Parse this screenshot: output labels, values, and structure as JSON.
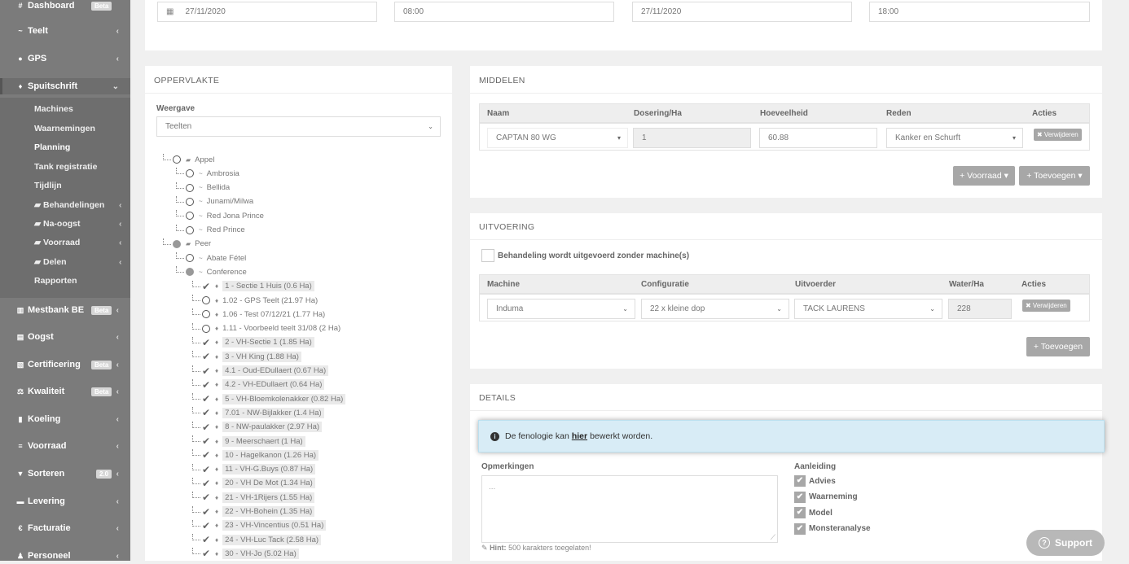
{
  "sidebar": {
    "items": [
      {
        "icon": "#",
        "label": "Dashboard",
        "badge": "Beta",
        "caret": ""
      },
      {
        "icon": "~",
        "label": "Teelt",
        "badge": "",
        "caret": "‹"
      },
      {
        "icon": "●",
        "label": "GPS",
        "badge": "",
        "caret": "‹"
      },
      {
        "icon": "♦",
        "label": "Spuitschrift",
        "badge": "",
        "caret": "⌄"
      },
      {
        "icon": "▥",
        "label": "Mestbank BE",
        "badge": "Beta",
        "caret": "‹"
      },
      {
        "icon": "▤",
        "label": "Oogst",
        "badge": "",
        "caret": "‹"
      },
      {
        "icon": "▧",
        "label": "Certificering",
        "badge": "Beta",
        "caret": "‹"
      },
      {
        "icon": "⚖",
        "label": "Kwaliteit",
        "badge": "Beta",
        "caret": "‹"
      },
      {
        "icon": "▮",
        "label": "Koeling",
        "badge": "",
        "caret": "‹"
      },
      {
        "icon": "≡",
        "label": "Voorraad",
        "badge": "",
        "caret": "‹"
      },
      {
        "icon": "▼",
        "label": "Sorteren",
        "badge": "2.0",
        "caret": "‹"
      },
      {
        "icon": "▬",
        "label": "Levering",
        "badge": "",
        "caret": "‹"
      },
      {
        "icon": "€",
        "label": "Facturatie",
        "badge": "",
        "caret": "‹"
      },
      {
        "icon": "♟",
        "label": "Personeel",
        "badge": "",
        "caret": "‹"
      }
    ],
    "sub": [
      {
        "label": "Machines",
        "caret": ""
      },
      {
        "label": "Waarnemingen",
        "caret": ""
      },
      {
        "label": "Planning",
        "caret": ""
      },
      {
        "label": "Tank registratie",
        "caret": ""
      },
      {
        "label": "Tijdlijn",
        "caret": ""
      },
      {
        "label": "▰ Behandelingen",
        "caret": "‹"
      },
      {
        "label": "▰ Na-oogst",
        "caret": "‹"
      },
      {
        "label": "▰ Voorraad",
        "caret": "‹"
      },
      {
        "label": "▰ Delen",
        "caret": "‹"
      },
      {
        "label": "Rapporten",
        "caret": ""
      }
    ]
  },
  "top": {
    "date1": "27/11/2020",
    "time1": "08:00",
    "date2": "27/11/2020",
    "time2": "18:00"
  },
  "oppervlakte": {
    "title": "OPPERVLAKTE",
    "weergave_label": "Weergave",
    "weergave_value": "Teelten",
    "tree": [
      {
        "level": 0,
        "state": "open",
        "icon": "▰",
        "text": "Appel",
        "hl": false
      },
      {
        "level": 1,
        "state": "open",
        "icon": "~",
        "text": "Ambrosia",
        "hl": false
      },
      {
        "level": 1,
        "state": "open",
        "icon": "~",
        "text": "Bellida",
        "hl": false
      },
      {
        "level": 1,
        "state": "open",
        "icon": "~",
        "text": "Junami/Milwa",
        "hl": false
      },
      {
        "level": 1,
        "state": "open",
        "icon": "~",
        "text": "Red Jona Prince",
        "hl": false
      },
      {
        "level": 1,
        "state": "open",
        "icon": "~",
        "text": "Red Prince",
        "hl": false
      },
      {
        "level": 0,
        "state": "filled",
        "icon": "▰",
        "text": "Peer",
        "hl": false
      },
      {
        "level": 1,
        "state": "open",
        "icon": "~",
        "text": "Abate Fétel",
        "hl": false
      },
      {
        "level": 1,
        "state": "filled",
        "icon": "~",
        "text": "Conference",
        "hl": false
      },
      {
        "level": 2,
        "state": "check",
        "icon": "♦",
        "text": "1 - Sectie 1 Huis (0.6 Ha)",
        "hl": true
      },
      {
        "level": 2,
        "state": "open",
        "icon": "♦",
        "text": "1.02 - GPS Teelt (21.97 Ha)",
        "hl": false
      },
      {
        "level": 2,
        "state": "open",
        "icon": "♦",
        "text": "1.06 - Test 07/12/21 (1.77 Ha)",
        "hl": false
      },
      {
        "level": 2,
        "state": "open",
        "icon": "♦",
        "text": "1.11 - Voorbeeld teelt 31/08 (2 Ha)",
        "hl": false
      },
      {
        "level": 2,
        "state": "check",
        "icon": "♦",
        "text": "2 - VH-Sectie 1 (1.85 Ha)",
        "hl": true
      },
      {
        "level": 2,
        "state": "check",
        "icon": "♦",
        "text": "3 - VH King (1.88 Ha)",
        "hl": true
      },
      {
        "level": 2,
        "state": "check",
        "icon": "♦",
        "text": "4.1 - Oud-EDullaert (0.67 Ha)",
        "hl": true
      },
      {
        "level": 2,
        "state": "check",
        "icon": "♦",
        "text": "4.2 - VH-EDullaert (0.64 Ha)",
        "hl": true
      },
      {
        "level": 2,
        "state": "check",
        "icon": "♦",
        "text": "5 - VH-Bloemkolenakker (0.82 Ha)",
        "hl": true
      },
      {
        "level": 2,
        "state": "check",
        "icon": "♦",
        "text": "7.01 - NW-Bijlakker (1.4 Ha)",
        "hl": true
      },
      {
        "level": 2,
        "state": "check",
        "icon": "♦",
        "text": "8 - NW-paulakker (2.97 Ha)",
        "hl": true
      },
      {
        "level": 2,
        "state": "check",
        "icon": "♦",
        "text": "9 - Meerschaert (1 Ha)",
        "hl": true
      },
      {
        "level": 2,
        "state": "check",
        "icon": "♦",
        "text": "10 - Hagelkanon (1.26 Ha)",
        "hl": true
      },
      {
        "level": 2,
        "state": "check",
        "icon": "♦",
        "text": "11 - VH-G.Buys (0.87 Ha)",
        "hl": true
      },
      {
        "level": 2,
        "state": "check",
        "icon": "♦",
        "text": "20 - VH De Mot (1.34 Ha)",
        "hl": true
      },
      {
        "level": 2,
        "state": "check",
        "icon": "♦",
        "text": "21 - VH-1Rijers (1.55 Ha)",
        "hl": true
      },
      {
        "level": 2,
        "state": "check",
        "icon": "♦",
        "text": "22 - VH-Bohein (1.35 Ha)",
        "hl": true
      },
      {
        "level": 2,
        "state": "check",
        "icon": "♦",
        "text": "23 - VH-Vincentius (0.51 Ha)",
        "hl": true
      },
      {
        "level": 2,
        "state": "check",
        "icon": "♦",
        "text": "24 - VH-Luc Tack (2.58 Ha)",
        "hl": true
      },
      {
        "level": 2,
        "state": "check",
        "icon": "♦",
        "text": "30 - VH-Jo (5.02 Ha)",
        "hl": true
      }
    ]
  },
  "middelen": {
    "title": "MIDDELEN",
    "headers": [
      "Naam",
      "Dosering/Ha",
      "Hoeveelheid",
      "Reden",
      "Acties"
    ],
    "row": {
      "naam": "CAPTAN 80 WG",
      "dosering": "1",
      "hoeveelheid": "60.88",
      "reden": "Kanker en Schurft",
      "action": "✖ Verwijderen"
    },
    "btn_voorraad": "+ Voorraad ▾",
    "btn_toevoegen": "+ Toevoegen ▾"
  },
  "uitvoering": {
    "title": "UITVOERING",
    "checkbox_label": "Behandeling wordt uitgevoerd zonder machine(s)",
    "headers": [
      "Machine",
      "Configuratie",
      "Uitvoerder",
      "Water/Ha",
      "Acties"
    ],
    "row": {
      "machine": "Induma",
      "config": "22 x kleine dop",
      "uitvoerder": "TACK LAURENS",
      "water": "228",
      "action": "✖ Verwijderen"
    },
    "btn_toevoegen": "+ Toevoegen"
  },
  "details": {
    "title": "DETAILS",
    "alert_pre": "De fenologie kan ",
    "alert_link": "hier",
    "alert_post": " bewerkt worden.",
    "opmerkingen_label": "Opmerkingen",
    "opmerkingen_placeholder": "...",
    "hint_label": "Hint:",
    "hint_text": " 500 karakters toegelaten!",
    "aanleiding_label": "Aanleiding",
    "aanleiding": [
      "Advies",
      "Waarneming",
      "Model",
      "Monsteranalyse"
    ]
  },
  "support": "Support"
}
